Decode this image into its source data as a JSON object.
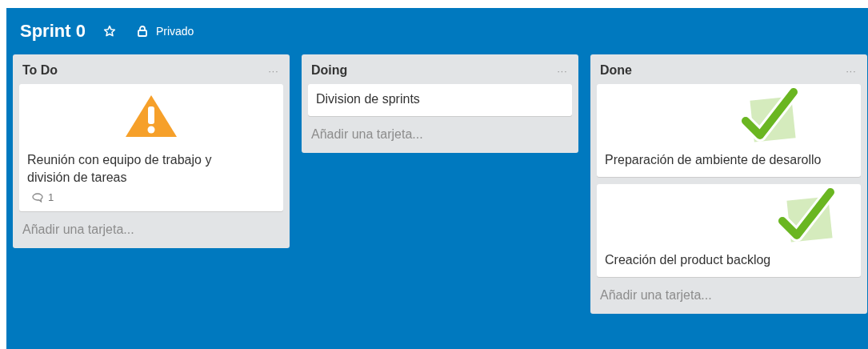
{
  "board": {
    "title": "Sprint 0",
    "starred": false,
    "visibility": "Privado"
  },
  "lists": [
    {
      "title": "To Do",
      "menu": "···",
      "cards": [
        {
          "kind": "warning",
          "title": "Reunión con equipo de trabajo y división de tareas",
          "comments": "1"
        }
      ],
      "add_card": "Añadir una tarjeta..."
    },
    {
      "title": "Doing",
      "menu": "···",
      "cards": [
        {
          "kind": "plain",
          "title": "Division de sprints"
        }
      ],
      "add_card": "Añadir una tarjeta..."
    },
    {
      "title": "Done",
      "menu": "···",
      "cards": [
        {
          "kind": "check",
          "title": "Preparación de ambiente de desarollo"
        },
        {
          "kind": "check",
          "title": "Creación del product backlog"
        }
      ],
      "add_card": "Añadir una tarjeta..."
    }
  ]
}
